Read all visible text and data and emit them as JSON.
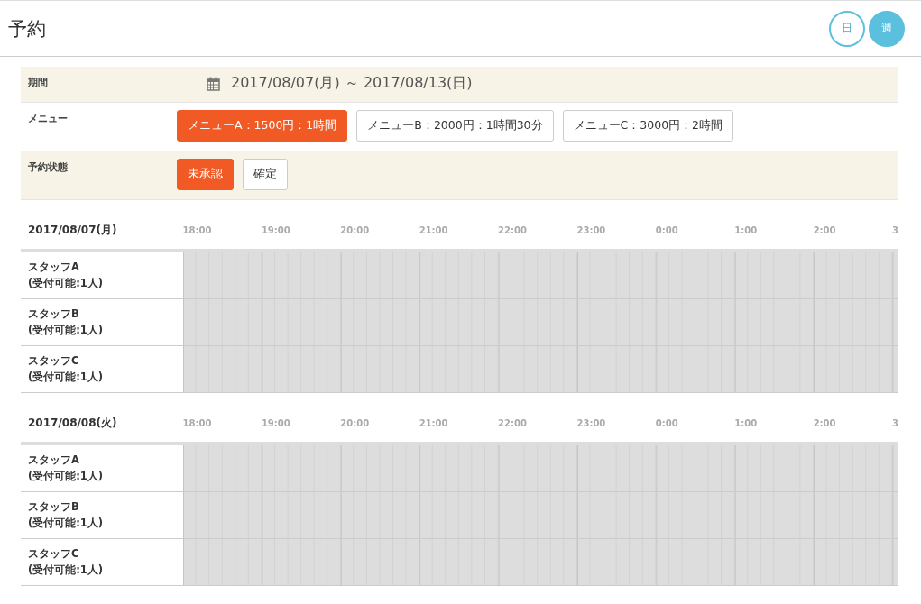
{
  "header": {
    "title": "予約",
    "view_toggles": [
      {
        "label": "日",
        "selected": false
      },
      {
        "label": "週",
        "selected": true
      }
    ]
  },
  "filters": [
    {
      "kind": "period",
      "label": "期間",
      "value": "2017/08/07(月) ～ 2017/08/13(日)"
    },
    {
      "kind": "options",
      "label": "メニュー",
      "options": [
        {
          "label": "メニューA：1500円：1時間",
          "selected": true
        },
        {
          "label": "メニューB：2000円：1時間30分",
          "selected": false
        },
        {
          "label": "メニューC：3000円：2時間",
          "selected": false
        }
      ]
    },
    {
      "kind": "options",
      "label": "予約状態",
      "options": [
        {
          "label": "未承認",
          "selected": true
        },
        {
          "label": "確定",
          "selected": false
        }
      ]
    }
  ],
  "days": [
    {
      "date": "2017/08/07(月)",
      "hours": [
        "18:00",
        "19:00",
        "20:00",
        "21:00",
        "22:00",
        "23:00",
        "0:00",
        "1:00",
        "2:00",
        "3"
      ],
      "staff": [
        {
          "name": "スタッフA",
          "capacity": "(受付可能:1人)"
        },
        {
          "name": "スタッフB",
          "capacity": "(受付可能:1人)"
        },
        {
          "name": "スタッフC",
          "capacity": "(受付可能:1人)"
        }
      ]
    },
    {
      "date": "2017/08/08(火)",
      "hours": [
        "18:00",
        "19:00",
        "20:00",
        "21:00",
        "22:00",
        "23:00",
        "0:00",
        "1:00",
        "2:00",
        "3"
      ],
      "staff": [
        {
          "name": "スタッフA",
          "capacity": "(受付可能:1人)"
        },
        {
          "name": "スタッフB",
          "capacity": "(受付可能:1人)"
        },
        {
          "name": "スタッフC",
          "capacity": "(受付可能:1人)"
        }
      ]
    }
  ]
}
